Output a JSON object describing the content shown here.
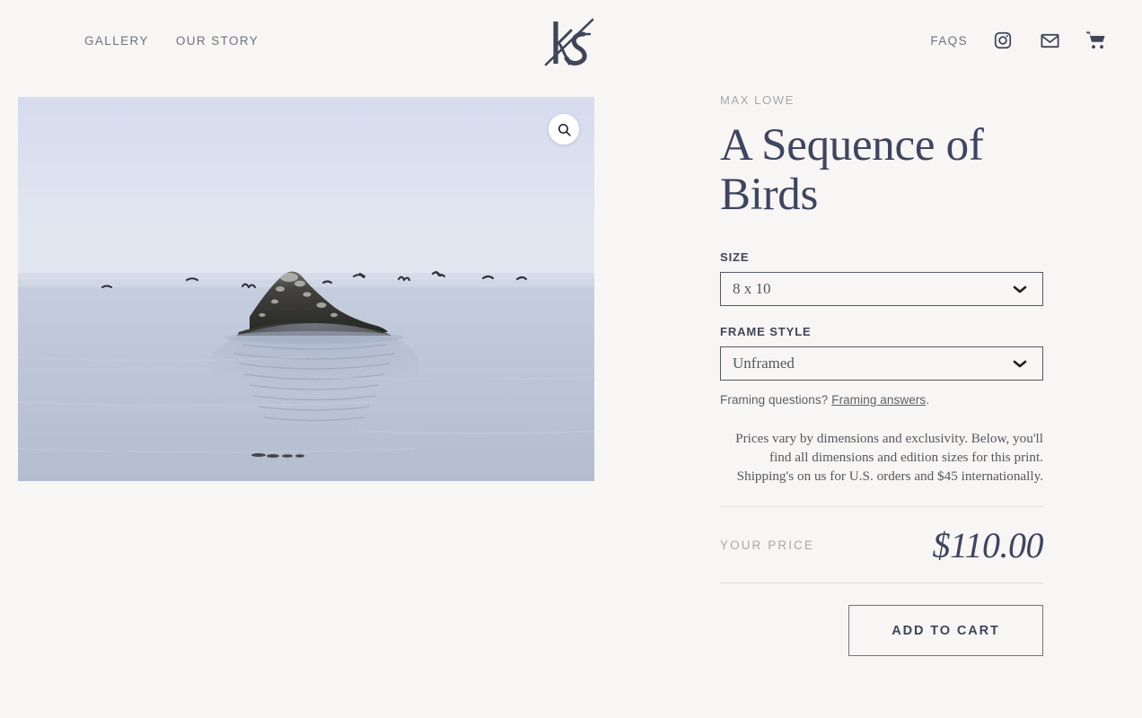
{
  "theme": {
    "page_background": "#f7f6f4",
    "text_dark": "#3d4560",
    "text_muted": "#a6a8ad",
    "border": "#535964"
  },
  "header": {
    "nav_left": [
      {
        "label": "GALLERY",
        "name": "nav-gallery"
      },
      {
        "label": "OUR STORY",
        "name": "nav-our-story"
      }
    ],
    "logo": {
      "name": "ks-monogram-logo",
      "alt": "ks"
    },
    "nav_right": {
      "faqs_label": "FAQS",
      "icons": [
        {
          "name": "instagram-icon"
        },
        {
          "name": "mail-icon"
        },
        {
          "name": "cart-icon"
        }
      ]
    }
  },
  "product_image": {
    "name": "product-photo",
    "alt": "A rocky sea stack in calm misty water with a line of birds flying above",
    "zoom_button": {
      "name": "zoom-icon",
      "label": "Zoom"
    }
  },
  "product": {
    "artist": "MAX LOWE",
    "title": "A Sequence of Birds",
    "options": [
      {
        "label": "SIZE",
        "value": "8 x 10",
        "name": "size-select",
        "options": [
          "8 x 10"
        ]
      },
      {
        "label": "FRAME STYLE",
        "value": "Unframed",
        "name": "frame-style-select",
        "options": [
          "Unframed"
        ]
      }
    ],
    "framing_note_prefix": "Framing questions? ",
    "framing_note_link": "Framing answers",
    "framing_note_suffix": ".",
    "description": "Prices vary by dimensions and exclusivity. Below, you'll find all dimensions and edition sizes for this print. Shipping's on us for U.S. orders and $45 internationally.",
    "price_label": "YOUR PRICE",
    "price_value": "$110.00",
    "add_to_cart_label": "ADD TO CART"
  }
}
